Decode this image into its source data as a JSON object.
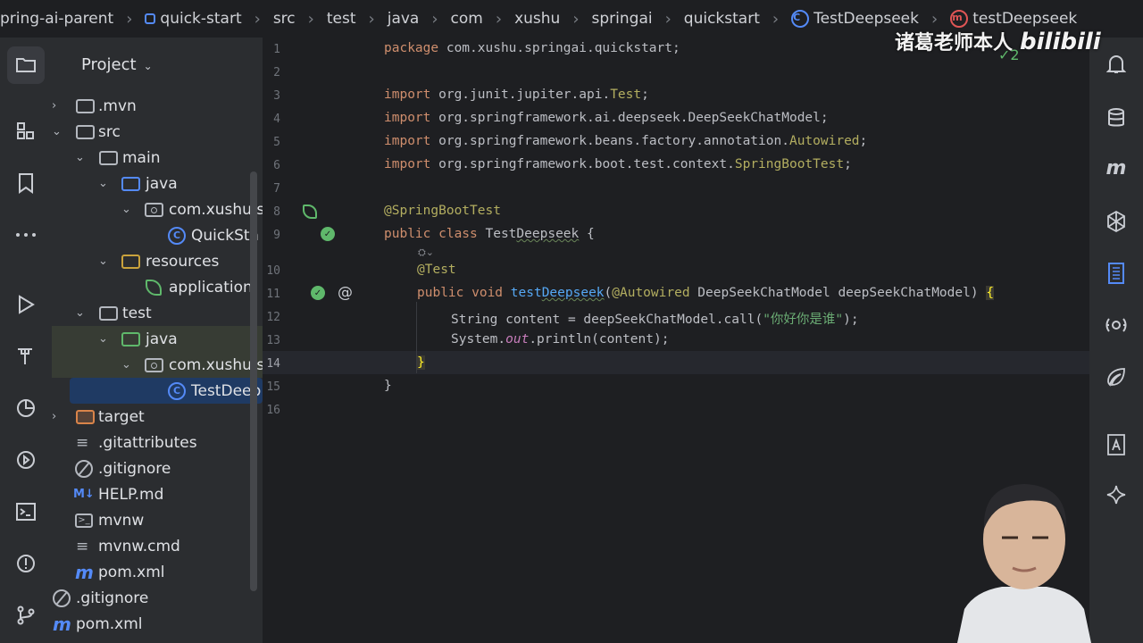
{
  "breadcrumb": {
    "items": [
      {
        "label": "pring-ai-parent",
        "icon": ""
      },
      {
        "label": "quick-start",
        "icon": "module-icon"
      },
      {
        "label": "src",
        "icon": ""
      },
      {
        "label": "test",
        "icon": ""
      },
      {
        "label": "java",
        "icon": ""
      },
      {
        "label": "com",
        "icon": ""
      },
      {
        "label": "xushu",
        "icon": ""
      },
      {
        "label": "springai",
        "icon": ""
      },
      {
        "label": "quickstart",
        "icon": ""
      },
      {
        "label": "TestDeepseek",
        "icon": "class-icon"
      },
      {
        "label": "testDeepseek",
        "icon": "method-icon"
      }
    ],
    "class_icon_letter": "C",
    "method_icon_letter": "m"
  },
  "left_toolbar": [
    "folder-icon",
    "structure-icon",
    "bookmark-icon",
    "more-icon",
    "run-icon",
    "build-icon",
    "profiler-icon",
    "services-icon",
    "terminal-icon",
    "problems-icon",
    "git-icon"
  ],
  "project_panel": {
    "title": "Project",
    "tree": [
      {
        "label": ".mvn",
        "icon": "folder-icon",
        "arrow": "›"
      },
      {
        "label": "src",
        "icon": "folder-icon",
        "arrow": "⌄"
      },
      {
        "label": "main",
        "icon": "folder-icon",
        "arrow": "⌄"
      },
      {
        "label": "java",
        "icon": "source-folder-icon",
        "arrow": "⌄"
      },
      {
        "label": "com.xushu.s",
        "icon": "package-icon",
        "arrow": "⌄"
      },
      {
        "label": "QuickSta",
        "icon": "class-icon",
        "arrow": ""
      },
      {
        "label": "resources",
        "icon": "resources-folder-icon",
        "arrow": "⌄"
      },
      {
        "label": "application.",
        "icon": "spring-leaf-icon",
        "arrow": ""
      },
      {
        "label": "test",
        "icon": "folder-icon",
        "arrow": "⌄"
      },
      {
        "label": "java",
        "icon": "test-folder-icon",
        "arrow": "⌄"
      },
      {
        "label": "com.xushu.s",
        "icon": "package-icon",
        "arrow": "⌄"
      },
      {
        "label": "TestDeep",
        "icon": "class-icon",
        "arrow": ""
      },
      {
        "label": "target",
        "icon": "excluded-folder-icon",
        "arrow": "›"
      },
      {
        "label": ".gitattributes",
        "icon": "text-file-icon",
        "arrow": ""
      },
      {
        "label": ".gitignore",
        "icon": "ignore-file-icon",
        "arrow": ""
      },
      {
        "label": "HELP.md",
        "icon": "markdown-icon",
        "arrow": ""
      },
      {
        "label": "mvnw",
        "icon": "shell-icon",
        "arrow": ""
      },
      {
        "label": "mvnw.cmd",
        "icon": "text-file-icon",
        "arrow": ""
      },
      {
        "label": "pom.xml",
        "icon": "maven-icon",
        "arrow": ""
      },
      {
        "label": ".gitignore",
        "icon": "ignore-file-icon",
        "arrow": ""
      },
      {
        "label": "pom.xml",
        "icon": "maven-icon",
        "arrow": ""
      }
    ],
    "icon_glyphs": {
      "markdown": "M↓",
      "shell": ">_",
      "text": "≡",
      "maven": "m",
      "class": "C"
    }
  },
  "editor": {
    "line_numbers": [
      "1",
      "2",
      "3",
      "4",
      "5",
      "6",
      "7",
      "8",
      "9",
      "10",
      "11",
      "12",
      "13",
      "14",
      "15",
      "16"
    ],
    "current_line": "14",
    "code": {
      "l1_kw": "package",
      "l1_rest": " com.xushu.springai.quickstart;",
      "l3_kw": "import",
      "l3_rest": " org.junit.jupiter.api.",
      "l3_ann": "Test",
      "l3_end": ";",
      "l4_kw": "import",
      "l4_rest": " org.springframework.ai.deepseek.DeepSeekChatModel;",
      "l5_kw": "import",
      "l5_rest": " org.springframework.beans.factory.annotation.",
      "l5_ann": "Autowired",
      "l5_end": ";",
      "l6_kw": "import",
      "l6_rest": " org.springframework.boot.test.context.",
      "l6_ann": "SpringBootTest",
      "l6_end": ";",
      "l8_ann": "@SpringBootTest",
      "l9_kw": "public class",
      "l9_sp": " Test",
      "l9_under": "Deepseek",
      "l9_end": " {",
      "l10_ann": "@Test",
      "l11_kw": "public void",
      "l11_sp": " ",
      "l11_fn_a": "test",
      "l11_fn_b": "Deepseek",
      "l11_paren": "(",
      "l11_ann": "@Autowired",
      "l11_rest": " DeepSeekChatModel deepSeekChatModel) ",
      "l11_brace": "{",
      "l12_a": "String content = deepSeekChatModel.call(",
      "l12_str": "\"你好你是谁\"",
      "l12_end": ");",
      "l13_a": "System.",
      "l13_it": "out",
      "l13_end": ".println(content);",
      "l14_brace": "}",
      "l15_brace": "}"
    },
    "hint_glyph": "⛭⌄",
    "gutter_icons": [
      "spring-bean-icon",
      "run-test-icon",
      "run-test-icon",
      "find-usages-icon"
    ]
  },
  "right_toolbar": [
    "notifications-icon",
    "database-icon",
    "maven-icon",
    "ai-assistant-icon",
    "gradle-icon",
    "endpoints-icon",
    "spring-icon",
    "font-icon",
    "ai-sparkle-icon"
  ],
  "overlay": {
    "watermark_text": "诸葛老师本人",
    "watermark_logo": "bilibili",
    "inspection_count": "2"
  },
  "colors": {
    "keyword": "#cf8e6d",
    "annotation": "#b3ae60",
    "function": "#56a8f5",
    "string": "#6aab73",
    "accent": "#548af7",
    "selection": "#1f3a63"
  }
}
